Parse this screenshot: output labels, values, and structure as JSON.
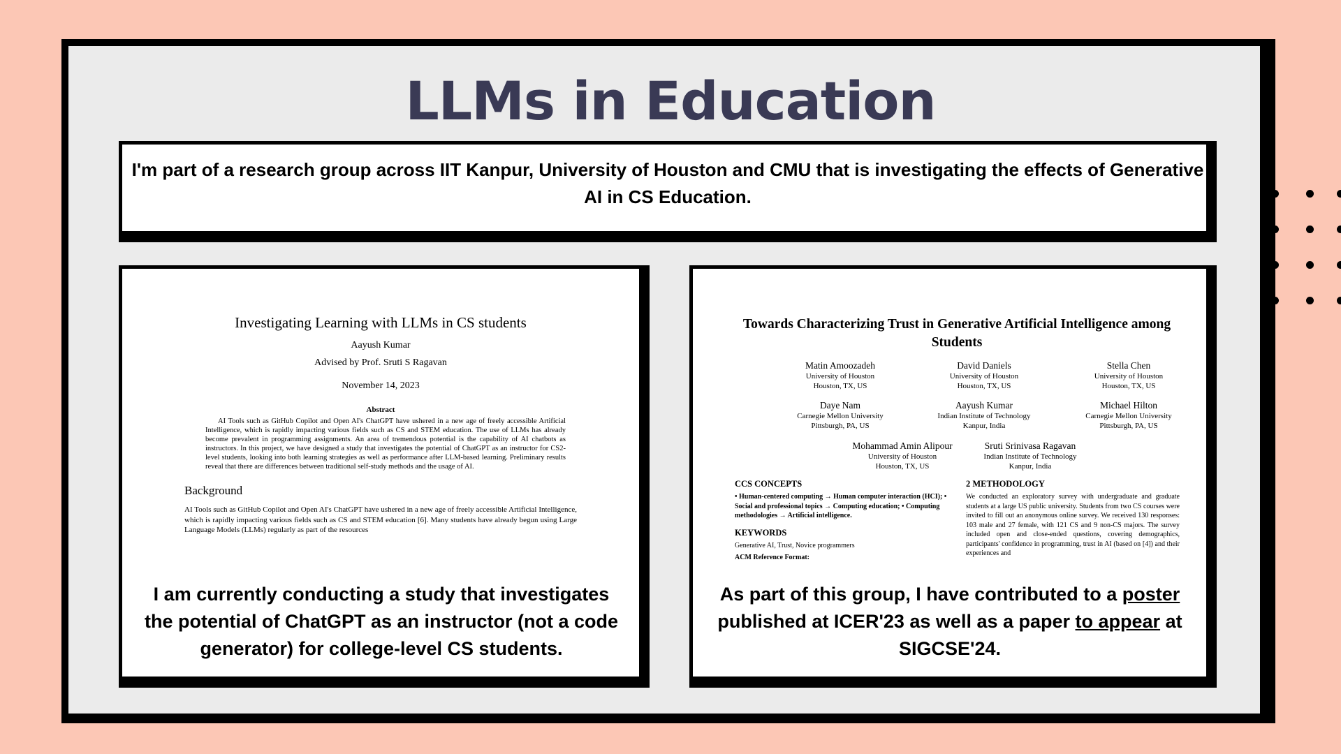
{
  "slide": {
    "title": "LLMs in Education",
    "intro": "I'm part of a research group across IIT Kanpur, University of Houston and CMU that is investigating the effects of Generative AI in CS Education."
  },
  "left_card": {
    "paper": {
      "title": "Investigating Learning with LLMs in CS students",
      "author": "Aayush Kumar",
      "advisor": "Advised by Prof. Sruti S Ragavan",
      "date": "November 14, 2023",
      "abstract_title": "Abstract",
      "abstract_text": "AI Tools such as GitHub Copilot and Open AI's ChatGPT have ushered in a new age of freely accessible Artificial Intelligence, which is rapidly impacting various fields such as CS and STEM education. The use of LLMs has already become prevalent in programming assignments. An area of tremendous potential is the capability of AI chatbots as instructors. In this project, we have designed a study that investigates the potential of ChatGPT as an instructor for CS2-level students, looking into both learning strategies as well as performance after LLM-based learning. Preliminary results reveal that there are differences between traditional self-study methods and the usage of AI.",
      "section_title": "Background",
      "section_text": "AI Tools such as GitHub Copilot and Open AI's ChatGPT have ushered in a new age of freely accessible Artificial Intelligence, which is rapidly impacting various fields such as CS and STEM education [6]. Many students have already begun using Large Language Models (LLMs) regularly as part of the resources"
    },
    "caption": "I am currently conducting a study that investigates the potential of ChatGPT as an instructor (not a code generator) for college-level CS students."
  },
  "right_card": {
    "paper": {
      "title": "Towards Characterizing Trust in Generative Artificial Intelligence among Students",
      "authors": [
        {
          "name": "Matin Amoozadeh",
          "aff": "University of Houston",
          "loc": "Houston, TX, US"
        },
        {
          "name": "David Daniels",
          "aff": "University of Houston",
          "loc": "Houston, TX, US"
        },
        {
          "name": "Stella Chen",
          "aff": "University of Houston",
          "loc": "Houston, TX, US"
        },
        {
          "name": "Daye Nam",
          "aff": "Carnegie Mellon University",
          "loc": "Pittsburgh, PA, US"
        },
        {
          "name": "Aayush Kumar",
          "aff": "Indian Institute of Technology",
          "loc": "Kanpur, India"
        },
        {
          "name": "Michael Hilton",
          "aff": "Carnegie Mellon University",
          "loc": "Pittsburgh, PA, US"
        },
        {
          "name": "Mohammad Amin Alipour",
          "aff": "University of Houston",
          "loc": "Houston, TX, US"
        },
        {
          "name": "Sruti Srinivasa Ragavan",
          "aff": "Indian Institute of Technology",
          "loc": "Kanpur, India"
        }
      ],
      "ccs_title": "CCS CONCEPTS",
      "ccs_text": "• Human-centered computing → Human computer interaction (HCI); • Social and professional topics → Computing education; • Computing methodologies → Artificial intelligence.",
      "keywords_title": "KEYWORDS",
      "keywords_text": "Generative AI, Trust, Novice programmers",
      "acm_ref": "ACM Reference Format:",
      "method_title": "2 METHODOLOGY",
      "method_text": "We conducted an exploratory survey with undergraduate and graduate students at a large US public university. Students from two CS courses were invited to fill out an anonymous online survey. We received 130 responses: 103 male and 27 female, with 121 CS and 9 non-CS majors. The survey included open and close-ended questions, covering demographics, participants' confidence in programming, trust in AI (based on [4]) and their experiences and"
    },
    "caption_part1": "As part of this group, I have contributed to a ",
    "caption_link1": "poster",
    "caption_part2": " published at ICER'23 as well as a paper ",
    "caption_link2": "to appear",
    "caption_part3": " at SIGCSE'24."
  }
}
